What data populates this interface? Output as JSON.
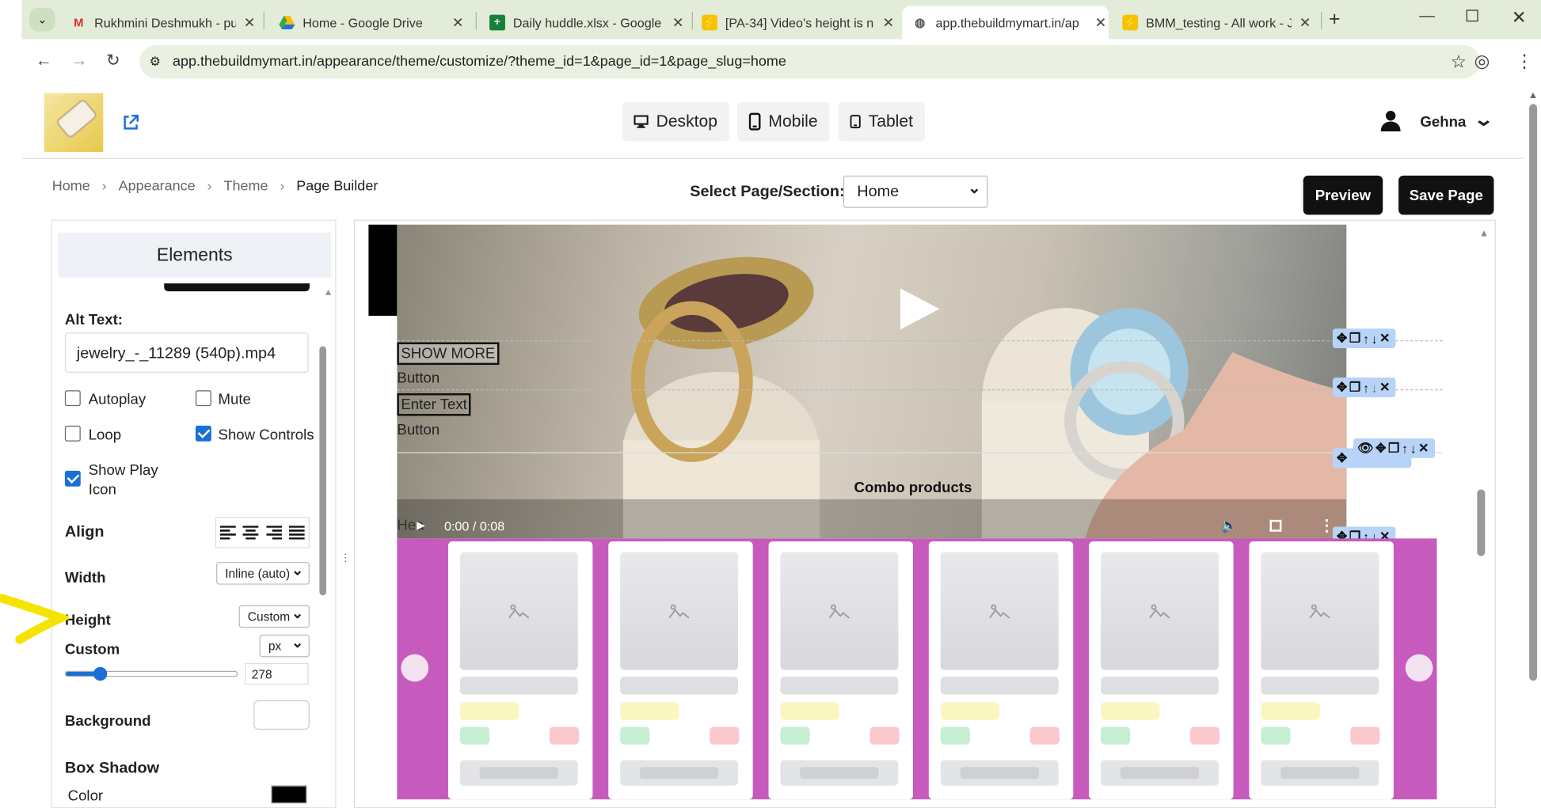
{
  "browser": {
    "tabs": [
      {
        "title": "Rukhmini Deshmukh - pun",
        "icon": "gmail-icon"
      },
      {
        "title": "Home - Google Drive",
        "icon": "drive-icon"
      },
      {
        "title": "Daily huddle.xlsx - Google",
        "icon": "sheets-icon"
      },
      {
        "title": "[PA-34] Video's height is n",
        "icon": "jira-icon"
      },
      {
        "title": "app.thebuildmymart.in/ap",
        "icon": "globe-icon"
      },
      {
        "title": "BMM_testing - All work - J",
        "icon": "jira-icon"
      }
    ],
    "url": "app.thebuildmymart.in/appearance/theme/customize/?theme_id=1&page_id=1&page_slug=home"
  },
  "header": {
    "devices": [
      "Desktop",
      "Mobile",
      "Tablet"
    ],
    "user": "Gehna"
  },
  "breadcrumb": [
    "Home",
    "Appearance",
    "Theme",
    "Page Builder"
  ],
  "page_select": {
    "label": "Select Page/Section:",
    "value": "Home"
  },
  "actions": {
    "preview": "Preview",
    "save": "Save Page"
  },
  "elements_panel": {
    "title": "Elements",
    "alt_text_label": "Alt Text:",
    "alt_text_value": "jewelry_-_11289 (540p).mp4",
    "autoplay": {
      "label": "Autoplay",
      "checked": false
    },
    "mute": {
      "label": "Mute",
      "checked": false
    },
    "loop": {
      "label": "Loop",
      "checked": false
    },
    "show_controls": {
      "label": "Show Controls",
      "checked": true
    },
    "show_play_icon": {
      "label1": "Show Play",
      "label2": "Icon",
      "checked": true
    },
    "align_label": "Align",
    "width_label": "Width",
    "width_value": "Inline (auto)",
    "height_label": "Height",
    "height_value": "Custom",
    "custom_label": "Custom",
    "unit_value": "px",
    "slider_value": "278",
    "slider_level": 0.2,
    "background_label": "Background",
    "box_shadow_label": "Box Shadow",
    "color_label": "Color",
    "shadow_color": "#000000"
  },
  "canvas": {
    "show_more": "SHOW MORE",
    "button1": "Button",
    "enter_text": "Enter Text",
    "button2": "Button",
    "combo": "Combo products",
    "heading_fragment": "Hea",
    "time": "0:00 / 0:08",
    "purple": "#c65bbd"
  }
}
